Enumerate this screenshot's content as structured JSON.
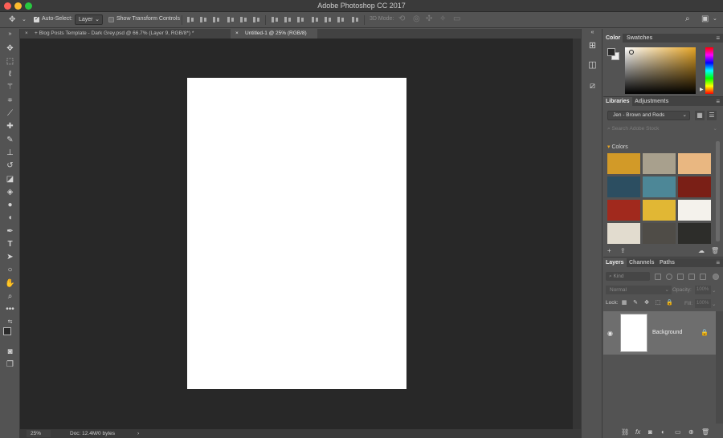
{
  "app": {
    "title": "Adobe Photoshop CC 2017",
    "brand_colors": {
      "close": "#fc5f57",
      "minimize": "#fdbc2e",
      "maximize": "#28c840"
    }
  },
  "options_bar": {
    "auto_select_label": "Auto-Select:",
    "auto_select_checked": true,
    "auto_select_value": "Layer",
    "transform_label": "Show Transform Controls",
    "transform_checked": false,
    "mode_3d_label": "3D Mode:"
  },
  "document_tabs": [
    {
      "label": "+ Blog Posts Template - Dark Grey.psd @ 66.7% (Layer 9, RGB/8*) *",
      "active": false
    },
    {
      "label": "Untitled-1 @ 25% (RGB/8)",
      "active": true
    }
  ],
  "status_bar": {
    "zoom": "25%",
    "doc_info": "Doc: 12.4M/0 bytes"
  },
  "tools": [
    "move-icon",
    "marquee-icon",
    "lasso-icon",
    "magic-wand-icon",
    "crop-icon",
    "eyedropper-icon",
    "healing-icon",
    "brush-icon",
    "stamp-icon",
    "history-brush-icon",
    "eraser-icon",
    "paint-bucket-icon",
    "blur-icon",
    "dodge-icon",
    "pen-icon",
    "type-icon",
    "path-select-icon",
    "shape-icon",
    "hand-icon",
    "zoom-icon",
    "more-tools-icon"
  ],
  "color_panel": {
    "tabs": [
      "Color",
      "Swatches"
    ],
    "active_tab": "Color",
    "foreground": "#2b2b2b",
    "background": "#ececec",
    "hue_base": "#e6a526"
  },
  "libraries_panel": {
    "tabs": [
      "Libraries",
      "Adjustments"
    ],
    "active_tab": "Libraries",
    "library_name": "Jen - Brown and Reds",
    "search_placeholder": "Search Adobe Stock",
    "section_label": "Colors",
    "swatches": [
      "#d29a28",
      "#a8a08d",
      "#e9b781",
      "#2c4e61",
      "#4d8797",
      "#7a1f16",
      "#a1291d",
      "#e1b734",
      "#f4f2ec",
      "#e2dccf",
      "#4f4c47",
      "#2d2d2a"
    ]
  },
  "layers_panel": {
    "tabs": [
      "Layers",
      "Channels",
      "Paths"
    ],
    "active_tab": "Layers",
    "kind_label": "Kind",
    "blend_mode": "Normal",
    "opacity_label": "Opacity:",
    "opacity_value": "100%",
    "lock_label": "Lock:",
    "fill_label": "Fill:",
    "fill_value": "100%",
    "layers": [
      {
        "name": "Background",
        "visible": true,
        "locked": true
      }
    ]
  }
}
